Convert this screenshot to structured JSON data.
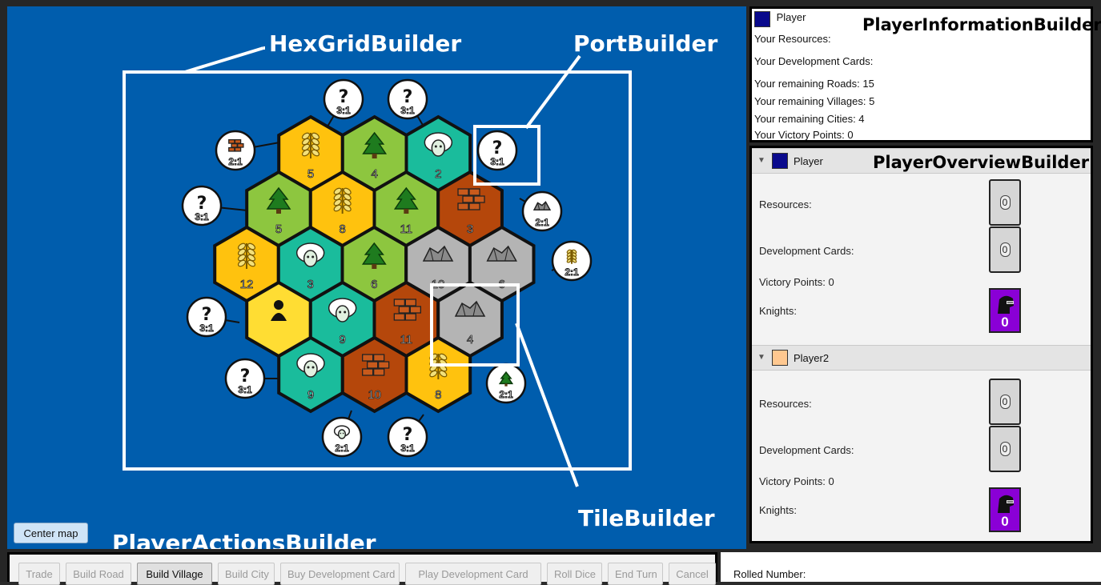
{
  "annotations": {
    "hexgrid": "HexGridBuilder",
    "port": "PortBuilder",
    "tile": "TileBuilder",
    "actions": "PlayerActionsBuilder",
    "player_info": "PlayerInformationBuilder",
    "overview": "PlayerOverviewBuilder"
  },
  "map": {
    "center_button": "Center map",
    "tiles": [
      {
        "type": "grain",
        "number": "5"
      },
      {
        "type": "lumber",
        "number": "4"
      },
      {
        "type": "wool",
        "number": "2"
      },
      {
        "type": "lumber",
        "number": "5"
      },
      {
        "type": "grain",
        "number": "8"
      },
      {
        "type": "lumber",
        "number": "11"
      },
      {
        "type": "brick",
        "number": "3"
      },
      {
        "type": "grain",
        "number": "12"
      },
      {
        "type": "wool",
        "number": "3"
      },
      {
        "type": "lumber",
        "number": "6"
      },
      {
        "type": "ore",
        "number": "10"
      },
      {
        "type": "ore",
        "number": "6"
      },
      {
        "type": "desert",
        "number": ""
      },
      {
        "type": "wool",
        "number": "9"
      },
      {
        "type": "brick",
        "number": "11"
      },
      {
        "type": "ore",
        "number": "4"
      },
      {
        "type": "wool",
        "number": "9"
      },
      {
        "type": "brick",
        "number": "10"
      },
      {
        "type": "grain",
        "number": "8"
      }
    ],
    "ports": [
      {
        "type": "generic",
        "ratio": "3:1"
      },
      {
        "type": "generic",
        "ratio": "3:1"
      },
      {
        "type": "brick",
        "ratio": "2:1"
      },
      {
        "type": "generic",
        "ratio": "3:1"
      },
      {
        "type": "generic",
        "ratio": "3:1"
      },
      {
        "type": "ore",
        "ratio": "2:1"
      },
      {
        "type": "generic",
        "ratio": "3:1"
      },
      {
        "type": "grain",
        "ratio": "2:1"
      },
      {
        "type": "generic",
        "ratio": "3:1"
      },
      {
        "type": "lumber",
        "ratio": "2:1"
      },
      {
        "type": "wool",
        "ratio": "2:1"
      },
      {
        "type": "generic",
        "ratio": "3:1"
      }
    ],
    "colors": {
      "sea": "#005dad",
      "grain": "#ffc20e",
      "lumber": "#8dc63f",
      "wool": "#1abc9c",
      "brick": "#b5470b",
      "ore": "#b4b4b4",
      "desert": "#ffdd33"
    }
  },
  "player_info": {
    "player_name": "Player",
    "player_color": "#0a0a8c",
    "resources_label": "Your Resources:",
    "dev_cards_label": "Your Development Cards:",
    "roads": "Your remaining Roads: 15",
    "villages": "Your remaining Villages: 5",
    "cities": "Your remaining Cities: 4",
    "victory_points": "Your Victory Points: 0"
  },
  "overview": {
    "players": [
      {
        "name": "Player",
        "color": "#0a0a8c",
        "resources_label": "Resources:",
        "resources_count": "0",
        "dev_cards_label": "Development Cards:",
        "dev_cards_count": "0",
        "victory_points": "Victory Points: 0",
        "knights_label": "Knights:",
        "knights_count": "0"
      },
      {
        "name": "Player2",
        "color": "#ffc890",
        "resources_label": "Resources:",
        "resources_count": "0",
        "dev_cards_label": "Development Cards:",
        "dev_cards_count": "0",
        "victory_points": "Victory Points: 0",
        "knights_label": "Knights:",
        "knights_count": "0"
      }
    ]
  },
  "actions": {
    "buttons": [
      {
        "label": "Trade",
        "enabled": false
      },
      {
        "label": "Build Road",
        "enabled": false
      },
      {
        "label": "Build Village",
        "enabled": true
      },
      {
        "label": "Build City",
        "enabled": false
      },
      {
        "label": "Buy Development Card",
        "enabled": false
      },
      {
        "label": "Play Development Card",
        "enabled": false
      },
      {
        "label": "Roll Dice",
        "enabled": false
      },
      {
        "label": "End Turn",
        "enabled": false
      },
      {
        "label": "Cancel",
        "enabled": false
      }
    ]
  },
  "rolled": {
    "label": "Rolled Number:"
  }
}
